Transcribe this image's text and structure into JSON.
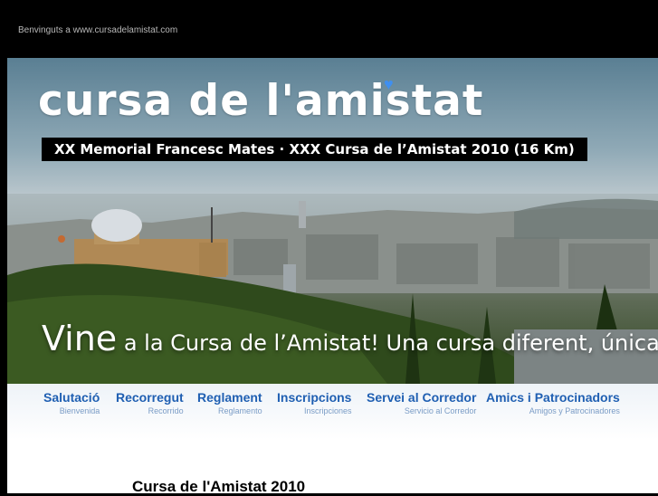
{
  "header": {
    "welcome": "Benvinguts a www.cursadelamistat.com"
  },
  "banner": {
    "logo": "cursa de l'amistat",
    "subtitle": "XX Memorial Francesc Mates · XXX Cursa de l’Amistat 2010 (16 Km)",
    "slogan_big": "Vine",
    "slogan_rest": " a la Cursa de l’Amistat! Una cursa diferent, única.",
    "heart_color": "#3f8ff0"
  },
  "nav": {
    "items": [
      {
        "label": "Salutació",
        "sub": "Bienvenida"
      },
      {
        "label": "Recorregut",
        "sub": "Recorrido"
      },
      {
        "label": "Reglament",
        "sub": "Reglamento"
      },
      {
        "label": "Inscripcions",
        "sub": "Inscripciones"
      },
      {
        "label": "Servei al Corredor",
        "sub": "Servicio al Corredor"
      },
      {
        "label": "Amics i Patrocinadors",
        "sub": "Amigos y Patrocinadores"
      }
    ],
    "link_color": "#1f5fb2"
  },
  "content": {
    "heading": "Cursa de l'Amistat 2010"
  }
}
